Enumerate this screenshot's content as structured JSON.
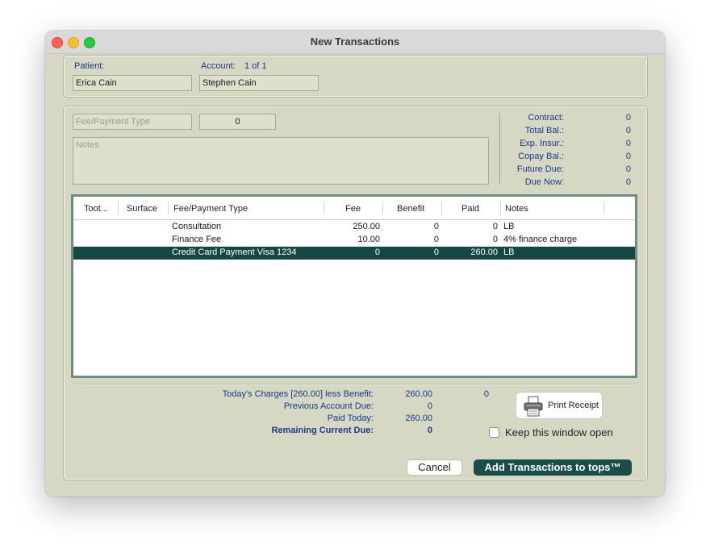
{
  "window": {
    "title": "New Transactions"
  },
  "patient": {
    "label": "Patient:",
    "value": "Erica Cain"
  },
  "account": {
    "label": "Account:",
    "count": "1 of 1",
    "value": "Stephen Cain"
  },
  "entry": {
    "fee_type_placeholder": "Fee/Payment Type",
    "amount_value": "0",
    "notes_placeholder": "Notes"
  },
  "summary": [
    {
      "label": "Contract:",
      "value": "0"
    },
    {
      "label": "Total Bal.:",
      "value": "0"
    },
    {
      "label": "Exp. Insur.:",
      "value": "0"
    },
    {
      "label": "Copay Bal.:",
      "value": "0"
    },
    {
      "label": "Future Due:",
      "value": "0"
    },
    {
      "label": "Due Now:",
      "value": "0"
    }
  ],
  "table": {
    "headers": [
      "Toot...",
      "Surface",
      "Fee/Payment Type",
      "Fee",
      "Benefit",
      "Paid",
      "Notes"
    ],
    "rows": [
      {
        "tooth": "",
        "surface": "",
        "type": "Consultation",
        "fee": "250.00",
        "benefit": "0",
        "paid": "0",
        "notes": "LB",
        "selected": false
      },
      {
        "tooth": "",
        "surface": "",
        "type": "Finance Fee",
        "fee": "10.00",
        "benefit": "0",
        "paid": "0",
        "notes": "4% finance charge",
        "selected": false
      },
      {
        "tooth": "",
        "surface": "",
        "type": "Credit Card Payment Visa 1234",
        "fee": "0",
        "benefit": "0",
        "paid": "260.00",
        "notes": "LB",
        "selected": true
      }
    ]
  },
  "totals": {
    "charges_label": "Today's Charges [260.00] less Benefit:",
    "charges_value": "260.00",
    "benefit_value": "0",
    "previous_label": "Previous Account Due:",
    "previous_value": "0",
    "paid_label": "Paid Today:",
    "paid_value": "260.00",
    "remaining_label": "Remaining Current Due:",
    "remaining_value": "0"
  },
  "actions": {
    "print_label": "Print Receipt",
    "keep_open_label": "Keep this window open",
    "cancel_label": "Cancel",
    "add_label": "Add Transactions to tops™"
  },
  "icons": {
    "print": "printer-icon"
  },
  "colors": {
    "selection": "#154845",
    "primary_button": "#194d48",
    "label_blue": "#1b3a8a",
    "panel_bg": "#d6d8c4"
  }
}
